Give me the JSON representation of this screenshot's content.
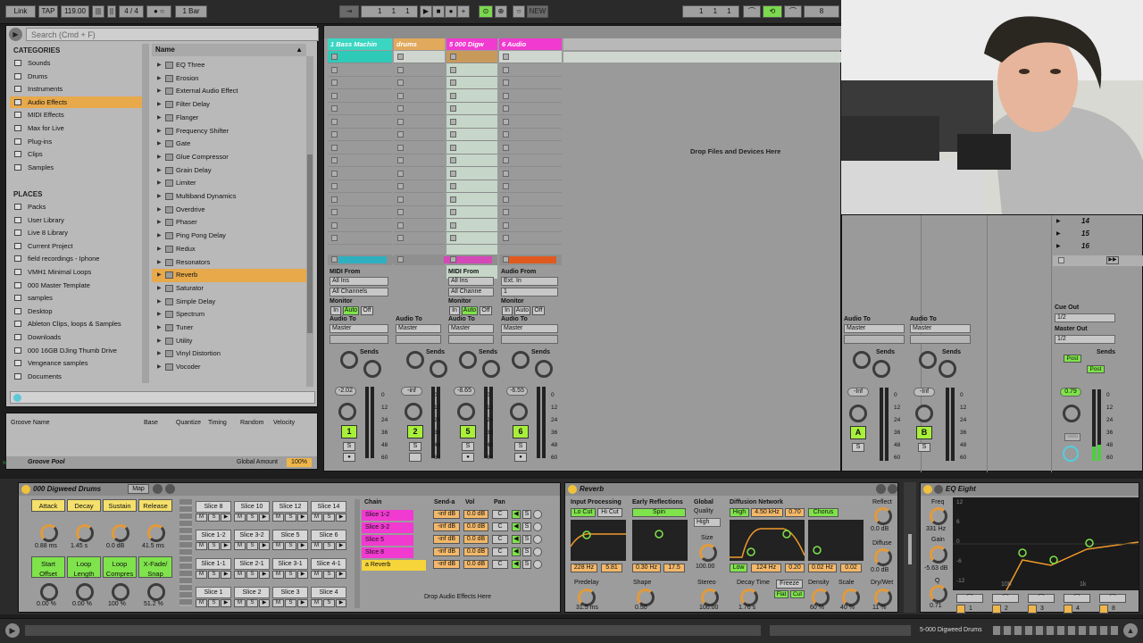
{
  "transport": {
    "link": "Link",
    "tap": "TAP",
    "tempo": "119.00",
    "meter": "4 / 4",
    "quant": "1 Bar",
    "pos1": "1",
    "pos2": "1",
    "pos3": "1",
    "new": "NEW",
    "pos4": "1",
    "pos5": "1",
    "pos6": "1",
    "loop_len": "8"
  },
  "browser": {
    "search_placeholder": "Search (Cmd + F)",
    "categories_title": "CATEGORIES",
    "categories": [
      "Sounds",
      "Drums",
      "Instruments",
      "Audio Effects",
      "MIDI Effects",
      "Max for Live",
      "Plug-ins",
      "Clips",
      "Samples"
    ],
    "places_title": "PLACES",
    "places": [
      "Packs",
      "User Library",
      "Live 8 Library",
      "Current Project",
      "field recordings - Iphone",
      "VMH1 Minimal Loops",
      "000 Master Template",
      "samples",
      "Desktop",
      "Ableton Clips, loops & Samples",
      "Downloads",
      "000 16GB DJing Thumb Drive",
      "Vengeance samples",
      "Documents"
    ],
    "name_header": "Name",
    "items": [
      "EQ Three",
      "Erosion",
      "External Audio Effect",
      "Filter Delay",
      "Flanger",
      "Frequency Shifter",
      "Gate",
      "Glue Compressor",
      "Grain Delay",
      "Limiter",
      "Multiband Dynamics",
      "Overdrive",
      "Phaser",
      "Ping Pong Delay",
      "Redux",
      "Resonators",
      "Reverb",
      "Saturator",
      "Simple Delay",
      "Spectrum",
      "Tuner",
      "Utility",
      "Vinyl Distortion",
      "Vocoder"
    ]
  },
  "groove": {
    "cols": [
      "Groove Name",
      "Base",
      "Quantize",
      "Timing",
      "Random",
      "Velocity"
    ],
    "title": "Groove Pool",
    "amount_label": "Global Amount",
    "amount": "100%"
  },
  "session": {
    "tracks": [
      {
        "name": "1 Bass Machin",
        "color": "#3ad6c2",
        "num": "1",
        "vol": "-2.02"
      },
      {
        "name": "drums",
        "color": "#e0a95c",
        "num": "2",
        "vol": "-inf"
      },
      {
        "name": "5 000 Digw",
        "color": "#f03ad0",
        "num": "5",
        "vol": "-8.65"
      },
      {
        "name": "6 Audio",
        "color": "#f03ad0",
        "num": "6",
        "vol": "-6.55"
      }
    ],
    "drop_text": "Drop Files and Devices Here",
    "midi_from": "MIDI From",
    "all_ins": "All Ins",
    "all_channels": "All Channels",
    "all_channe": "All Channe",
    "audio_from": "Audio From",
    "ext_in": "Ext. In",
    "ch1": "1",
    "monitor": "Monitor",
    "in": "In",
    "auto": "Auto",
    "off": "Off",
    "audio_to": "Audio To",
    "master": "Master",
    "sends": "Sends",
    "s": "S"
  },
  "right": {
    "scenes": [
      "14",
      "15",
      "16"
    ],
    "returns": [
      {
        "num": "A",
        "vol": "-Inf"
      },
      {
        "num": "B",
        "vol": "-Inf"
      }
    ],
    "cue_out": "Cue Out",
    "cue_val": "1/2",
    "master_out": "Master Out",
    "master_val": "1/2",
    "post": "Post",
    "master_vol": "0.79",
    "solo": "Solo",
    "audio_to": "Audio To",
    "master": "Master",
    "sends": "Sends",
    "s": "S"
  },
  "db_scale": [
    "0",
    "12",
    "24",
    "36",
    "48",
    "60"
  ],
  "drum": {
    "title": "000 Digweed Drums",
    "map": "Map",
    "env": [
      {
        "l": "Attack",
        "v": "0.88 ms"
      },
      {
        "l": "Decay",
        "v": "1.45 s"
      },
      {
        "l": "Sustain",
        "v": "0.0 dB"
      },
      {
        "l": "Release",
        "v": "41.5 ms"
      }
    ],
    "loop": [
      {
        "l": "Start Offset",
        "v": "0.00 %"
      },
      {
        "l": "Loop Length",
        "v": "0.00 %"
      },
      {
        "l": "Loop Compres",
        "v": "100 %"
      },
      {
        "l": "X-Fade/ Snap",
        "v": "51.2 %"
      }
    ],
    "pads": [
      "Slice 8",
      "Slice 10",
      "Slice 12",
      "Slice 14",
      "Slice 1-2",
      "Slice 3-2",
      "Slice 5",
      "Slice 6",
      "Slice 1-1",
      "Slice 2-1",
      "Slice 3-1",
      "Slice 4-1",
      "Slice 1",
      "Slice 2",
      "Slice 3",
      "Slice 4"
    ],
    "m": "M",
    "s": "S",
    "chain_cols": [
      "Chain",
      "Send-a",
      "Vol",
      "Pan"
    ],
    "chains": [
      "Slice 1-2",
      "Slice 3-2",
      "Slice 5",
      "Slice 8"
    ],
    "chain_vals": {
      "send": "-inf dB",
      "vol": "0.0 dB",
      "pan": "C"
    },
    "return_chain": "a Reverb",
    "drop": "Drop Audio Effects Here"
  },
  "reverb": {
    "title": "Reverb",
    "input": "Input Processing",
    "lowcut": "Lo Cut",
    "hicut": "Hi Cut",
    "early": "Early Reflections",
    "spin": "Spin",
    "global": "Global",
    "quality": "Quality",
    "high_q": "High",
    "diffusion": "Diffusion Network",
    "high": "High",
    "freq": "4.50 kHz",
    "hv": "0.70",
    "chorus": "Chorus",
    "reflect": "Reflect",
    "reflect_v": "0.0 dB",
    "diffuse": "Diffuse",
    "diffuse_v": "0.0 dB",
    "v1": "228 Hz",
    "v2": "5.81",
    "v3": "0.30 Hz",
    "v4": "17.5",
    "low": "Low",
    "v5": "124 Hz",
    "v6": "0.20",
    "v7": "0.02 Hz",
    "v8": "0.02",
    "size": "Size",
    "size_v": "100.00",
    "knobs": [
      {
        "l": "Predelay",
        "v": "31.5 ms"
      },
      {
        "l": "Shape",
        "v": "0.50"
      },
      {
        "l": "Stereo",
        "v": "100.00"
      },
      {
        "l": "Decay Time",
        "v": "1.76 s"
      },
      {
        "l": "Density",
        "v": "60 %"
      },
      {
        "l": "Scale",
        "v": "40 %"
      },
      {
        "l": "Dry/Wet",
        "v": "11 %"
      }
    ],
    "freeze": "Freeze",
    "flat": "Flat",
    "cut": "Cut"
  },
  "eq": {
    "title": "EQ Eight",
    "freq": "Freq",
    "freq_v": "331 Hz",
    "gain": "Gain",
    "gain_v": "-5.63 dB",
    "q": "Q",
    "q_v": "0.71",
    "scale": [
      "12",
      "6",
      "0",
      "-6",
      "-12"
    ],
    "x1": "100",
    "x2": "1k",
    "bands": [
      "1",
      "2",
      "3",
      "4",
      "8"
    ]
  },
  "status": {
    "device_name": "5-000 Digweed Drums"
  }
}
